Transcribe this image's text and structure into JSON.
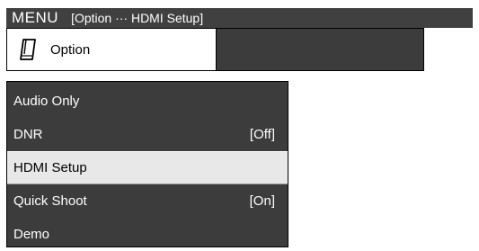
{
  "header": {
    "title": "MENU",
    "path": "[Option ··· HDMI Setup]"
  },
  "tabs": [
    {
      "label": "Option",
      "icon": "remote-icon"
    }
  ],
  "options": [
    {
      "label": "Audio Only",
      "value": ""
    },
    {
      "label": "DNR",
      "value": "[Off]"
    },
    {
      "label": "HDMI Setup",
      "value": ""
    },
    {
      "label": "Quick Shoot",
      "value": "[On]"
    },
    {
      "label": "Demo",
      "value": ""
    }
  ],
  "selected_option": "HDMI Setup",
  "colors": {
    "header_bg": "#404040",
    "panel_bg": "#3c3c3c",
    "highlight_bg": "#e8e8e8"
  }
}
